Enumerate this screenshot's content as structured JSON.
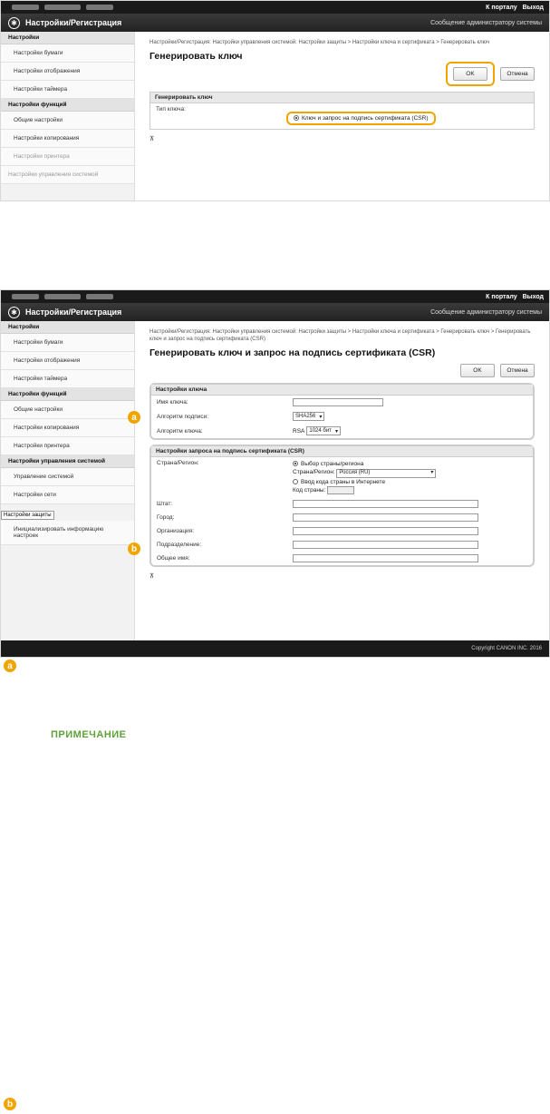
{
  "common": {
    "top_links": [
      "К порталу",
      "Выход"
    ],
    "app_title": "Настройки/Регистрация",
    "admin_msg": "Сообщение администратору системы",
    "ok": "OK",
    "cancel": "Отмена",
    "top_marker": "⊼"
  },
  "shot1": {
    "sidebar": {
      "h1": "Настройки",
      "items1": [
        "Настройки бумаги",
        "Настройки отображения",
        "Настройки таймера"
      ],
      "h2": "Настройки функций",
      "items2": [
        "Общие настройки",
        "Настройки копирования",
        "Настройки принтера"
      ],
      "h3": "Настройки управления системой"
    },
    "breadcrumb": "Настройки/Регистрация: Настройки управления системой: Настройки защиты > Настройки ключа и сертификата > Генерировать ключ",
    "heading": "Генерировать ключ",
    "section_title": "Генерировать ключ",
    "key_type_label": "Тип ключа:",
    "key_option": "Ключ и запрос на подпись сертификата (CSR)"
  },
  "shot2": {
    "sidebar": {
      "h1": "Настройки",
      "items1": [
        "Настройки бумаги",
        "Настройки отображения",
        "Настройки таймера"
      ],
      "h2": "Настройки функций",
      "items2": [
        "Общие настройки",
        "Настройки копирования",
        "Настройки принтера"
      ],
      "h3": "Настройки управления системой",
      "items3": [
        "Управление системой",
        "Настройки сети",
        "Настройки защиты",
        "Инициализировать информацию настроек"
      ]
    },
    "breadcrumb": "Настройки/Регистрация: Настройки управления системой: Настройки защиты > Настройки ключа и сертификата > Генерировать ключ > Генерировать ключ и запрос на подпись сертификата (CSR)",
    "heading": "Генерировать ключ и запрос на подпись сертификата (CSR)",
    "key_section": {
      "title": "Настройки ключа",
      "name_label": "Имя ключа:",
      "sig_label": "Алгоритм подписи:",
      "sig_value": "SHA256",
      "key_alg_label": "Алгоритм ключа:",
      "key_alg_prefix": "RSA",
      "key_alg_value": "1024 бит"
    },
    "csr_section": {
      "title": "Настройки запроса на подпись сертификата (CSR)",
      "country_label": "Страна/Регион:",
      "opt_select": "Выбор страны/региона",
      "country_sel_label": "Страна/Регион:",
      "country_value": "Россия (RU)",
      "opt_internet": "Ввод кода страны в Интернете",
      "code_label": "Код страны:",
      "fields": [
        "Штат:",
        "Город:",
        "Организация:",
        "Подразделение:",
        "Общее имя:"
      ]
    },
    "copyright": "Copyright CANON INC. 2016"
  },
  "badges": {
    "a": "a",
    "b": "b"
  },
  "note_title": "ПРИМЕЧАНИЕ"
}
